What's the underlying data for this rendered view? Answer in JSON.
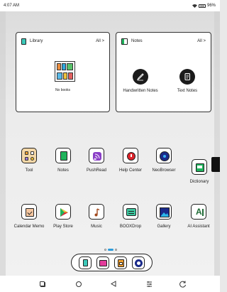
{
  "status": {
    "time": "4:07 AM",
    "battery": "96%",
    "wifi_icon": "wifi-icon",
    "battery_icon": "battery-icon"
  },
  "library": {
    "title": "Library",
    "all": "All >",
    "empty": "No books",
    "icon": "library-icon"
  },
  "notes": {
    "title": "Notes",
    "all": "All >",
    "handwritten": "Handwritten Notes",
    "text": "Text Notes"
  },
  "apps": [
    {
      "label": "Tool",
      "icon": "tool-grid-icon"
    },
    {
      "label": "Notes",
      "icon": "notes-icon"
    },
    {
      "label": "PushRead",
      "icon": "pushread-icon"
    },
    {
      "label": "Help Center",
      "icon": "help-center-icon"
    },
    {
      "label": "NeoBrowser",
      "icon": "browser-icon"
    },
    {
      "label": "Dictionary",
      "icon": "dictionary-icon"
    },
    {
      "label": "Calendar Memo",
      "icon": "calendar-icon"
    },
    {
      "label": "Play Store",
      "icon": "play-store-icon"
    },
    {
      "label": "Music",
      "icon": "music-icon"
    },
    {
      "label": "BOOXDrop",
      "icon": "booxdrop-icon"
    },
    {
      "label": "Gallery",
      "icon": "gallery-icon"
    },
    {
      "label": "AI Assistant",
      "icon": "ai-assistant-icon"
    }
  ],
  "page_indicator": {
    "pages": 3,
    "current": 2
  },
  "dock": [
    "library-icon",
    "shop-icon",
    "storage-icon",
    "settings-icon"
  ],
  "nav": [
    "recents-icon",
    "home-icon",
    "back-icon",
    "refresh-settings-icon",
    "refresh-icon"
  ]
}
